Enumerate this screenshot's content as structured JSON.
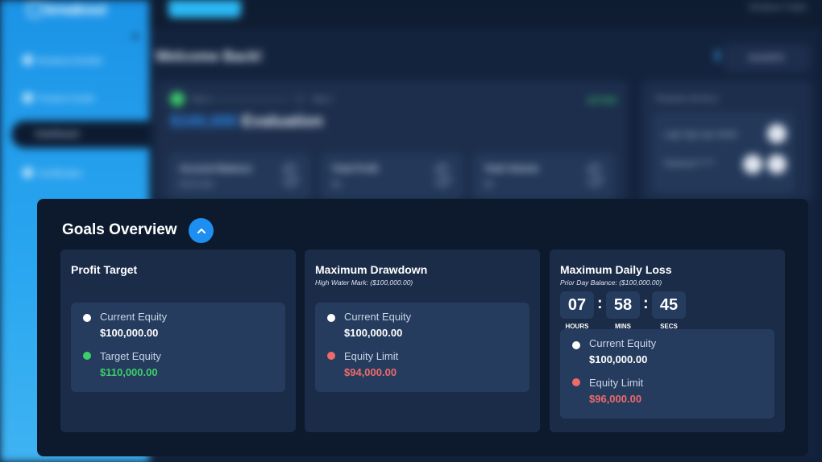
{
  "background": {
    "logo": "breakout",
    "nav": [
      "Breakout Builder",
      "Product Guide",
      "Dashboard",
      "Certificates"
    ],
    "top_button": "Start Challenge",
    "trader_name": "Breakout Trader",
    "welcome": "Welcome Back!",
    "account_select": "44444878",
    "step1": "Step 1",
    "step2": "Step 2",
    "status": "ACTIVE",
    "eval_amount": "$100,000",
    "eval_label": "Evaluation",
    "stats": [
      {
        "label": "Account Balance",
        "value": "$100,000"
      },
      {
        "label": "Total Profit",
        "value": "$0"
      },
      {
        "label": "Total Volume",
        "value": "$0"
      }
    ],
    "credentials": {
      "title": "TRADING DETAILS",
      "login": "Login  Sign uaer 44444",
      "password": "Password  ******"
    }
  },
  "goals": {
    "title": "Goals Overview",
    "cards": [
      {
        "title": "Profit Target",
        "subtitle": "",
        "metrics": [
          {
            "label": "Current Equity",
            "value": "$100,000.00",
            "dot": "#ffffff",
            "value_color": "#ffffff"
          },
          {
            "label": "Target Equity",
            "value": "$110,000.00",
            "dot": "#3ccf6a",
            "value_color": "#3ccf6a"
          }
        ]
      },
      {
        "title": "Maximum Drawdown",
        "subtitle": "High Water Mark: ($100,000.00)",
        "metrics": [
          {
            "label": "Current Equity",
            "value": "$100,000.00",
            "dot": "#ffffff",
            "value_color": "#ffffff"
          },
          {
            "label": "Equity Limit",
            "value": "$94,000.00",
            "dot": "#f06a6a",
            "value_color": "#f06a6a"
          }
        ]
      },
      {
        "title": "Maximum Daily Loss",
        "subtitle": "Prior Day Balance: ($100,000.00)",
        "timer": {
          "hours": "07",
          "mins": "58",
          "secs": "45",
          "hours_label": "HOURS",
          "mins_label": "MINS",
          "secs_label": "SECS",
          "separator": ":"
        },
        "metrics": [
          {
            "label": "Current Equity",
            "value": "$100,000.00",
            "dot": "#ffffff",
            "value_color": "#ffffff"
          },
          {
            "label": "Equity Limit",
            "value": "$96,000.00",
            "dot": "#f06a6a",
            "value_color": "#f06a6a"
          }
        ]
      }
    ]
  },
  "colors": {
    "accent": "#1e8ff0",
    "positive": "#3ccf6a",
    "negative": "#f06a6a"
  },
  "icons": {
    "collapse": "chevron-up-icon"
  }
}
